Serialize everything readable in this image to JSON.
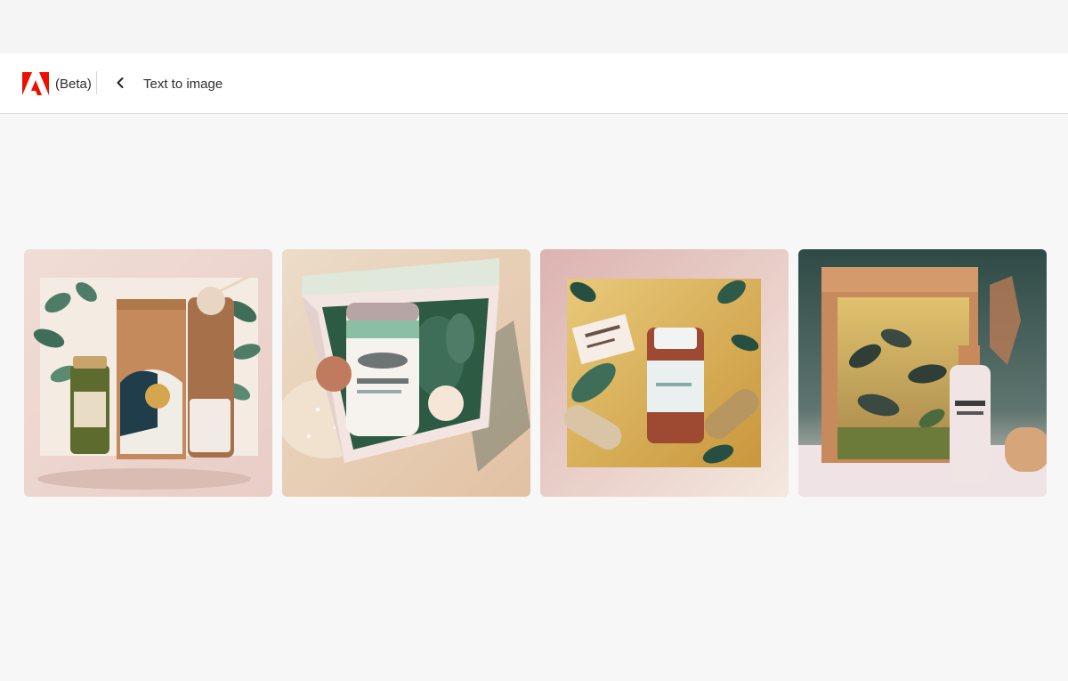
{
  "app": {
    "beta_label": "(Beta)",
    "page_title": "Text to image",
    "brand_color": "#eb1000"
  },
  "icons": {
    "logo": "adobe-logo-icon",
    "back": "chevron-left-icon"
  },
  "gallery": {
    "images": [
      {
        "name": "generated-image-1",
        "palette": [
          "#efd8d2",
          "#c48a5c",
          "#3f6e58"
        ]
      },
      {
        "name": "generated-image-2",
        "palette": [
          "#e8cfb4",
          "#f3e5e1",
          "#2d5a43"
        ]
      },
      {
        "name": "generated-image-3",
        "palette": [
          "#e9c7bf",
          "#d6a64e",
          "#274f41"
        ]
      },
      {
        "name": "generated-image-4",
        "palette": [
          "#37504a",
          "#c78a5d",
          "#f0e3e6"
        ]
      }
    ]
  }
}
